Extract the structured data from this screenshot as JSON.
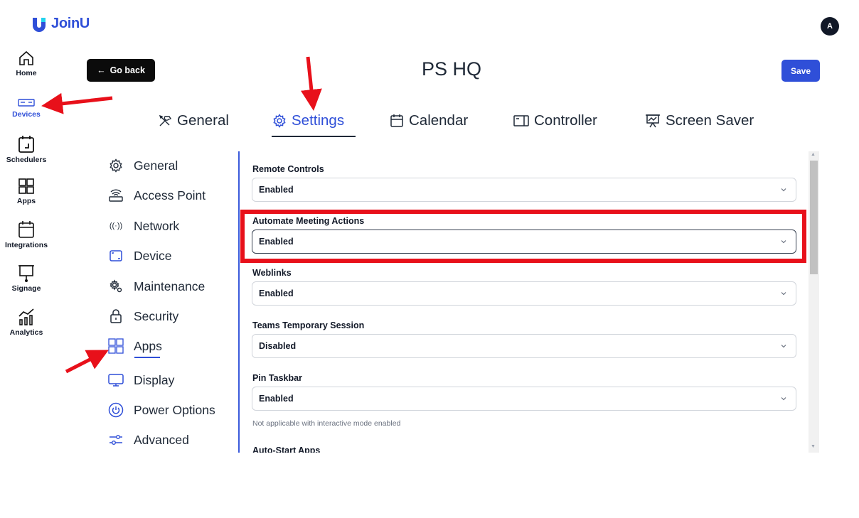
{
  "app": {
    "name": "JoinU",
    "avatar_initial": "A"
  },
  "rail": [
    {
      "label": "Home",
      "icon": "home-icon"
    },
    {
      "label": "Devices",
      "icon": "device-icon",
      "active": true
    },
    {
      "label": "Schedulers",
      "icon": "scheduler-icon"
    },
    {
      "label": "Apps",
      "icon": "apps-grid-icon"
    },
    {
      "label": "Integrations",
      "icon": "calendar-icon"
    },
    {
      "label": "Signage",
      "icon": "signage-icon"
    },
    {
      "label": "Analytics",
      "icon": "analytics-icon"
    }
  ],
  "header": {
    "go_back": "Go back",
    "title": "PS HQ",
    "save": "Save"
  },
  "tabs": [
    {
      "label": "General",
      "icon": "tools-icon"
    },
    {
      "label": "Settings",
      "icon": "gear-icon",
      "active": true
    },
    {
      "label": "Calendar",
      "icon": "calendar-icon"
    },
    {
      "label": "Controller",
      "icon": "controller-icon"
    },
    {
      "label": "Screen Saver",
      "icon": "screensaver-icon"
    }
  ],
  "menu": [
    {
      "label": "General",
      "icon": "gear-icon"
    },
    {
      "label": "Access Point",
      "icon": "router-icon"
    },
    {
      "label": "Network",
      "icon": "signal-icon"
    },
    {
      "label": "Device",
      "icon": "device-icon"
    },
    {
      "label": "Maintenance",
      "icon": "maintenance-icon"
    },
    {
      "label": "Security",
      "icon": "lock-icon"
    },
    {
      "label": "Apps",
      "icon": "apps-grid-icon",
      "active": true
    },
    {
      "label": "Display",
      "icon": "monitor-icon"
    },
    {
      "label": "Power Options",
      "icon": "power-icon"
    },
    {
      "label": "Advanced",
      "icon": "sliders-icon"
    }
  ],
  "settings": [
    {
      "label": "Remote Controls",
      "value": "Enabled"
    },
    {
      "label": "Automate Meeting Actions",
      "value": "Enabled"
    },
    {
      "label": "Weblinks",
      "value": "Enabled"
    },
    {
      "label": "Teams Temporary Session",
      "value": "Disabled"
    },
    {
      "label": "Pin Taskbar",
      "value": "Enabled",
      "hint": "Not applicable with interactive mode enabled"
    },
    {
      "label": "Auto-Start Apps"
    }
  ],
  "colors": {
    "accent": "#2f4fd8",
    "highlight": "#e8101a",
    "annotation_arrow": "#e8101a"
  }
}
